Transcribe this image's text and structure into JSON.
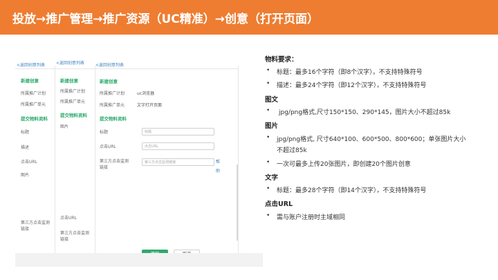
{
  "banner": {
    "title": "投放→推广管理→推广资源（UC精准）→创意（打开页面）"
  },
  "screenshot": {
    "back_links": [
      "返回创意列表",
      "返回创意列表",
      "返回创意列表"
    ],
    "col1": {
      "section_new": "新建创意",
      "plan_label": "所属推广计划",
      "unit_label": "所属推广单元",
      "section_submit": "提交物料资料",
      "title_label": "标题",
      "desc_label": "描述",
      "url_label": "点击URL",
      "image_label": "图片",
      "tracking_label_1": "第三方点击监测",
      "tracking_label_2": "链接"
    },
    "col2": {
      "section_new": "新建创意",
      "plan_label": "所属推广计划",
      "unit_label": "所属推广单元",
      "section_submit": "提交物料资料",
      "image_label": "图片",
      "url_label": "点击URL",
      "tracking_label_1": "第三方点击监测",
      "tracking_label_2": "链接"
    },
    "col3": {
      "section_new": "新建创意",
      "plan_label": "所属推广计划",
      "plan_value": "uc浏览器",
      "unit_label": "所属推广单元",
      "unit_value": "文字打开页面",
      "section_submit": "提交物料资料",
      "title_label": "标题",
      "title_placeholder": "标题",
      "url_label": "点击URL",
      "url_placeholder": "点击URL",
      "tracking_label_1": "第三方点击监测",
      "tracking_label_2": "链接",
      "tracking_placeholder": "第三方点击监测链接",
      "side_link_1": "帮",
      "side_link_2": "助"
    },
    "confirm_button": "确定",
    "cancel_button": "取消"
  },
  "requirements": {
    "heading": "物料要求：",
    "items": [
      {
        "type": "bullet",
        "text": "标题：最多16个字符（即8个汉字），不支持特殊符号"
      },
      {
        "type": "bullet",
        "text": "描述：最多24个字符（即12个汉字），不支持特殊符号"
      },
      {
        "type": "heading",
        "text": "图文"
      },
      {
        "type": "bullet",
        "text": "jpg/png格式,尺寸150*150、290*145，图片大小不超过85k"
      },
      {
        "type": "heading",
        "text": "图片"
      },
      {
        "type": "bullet",
        "text": "jpg/png格式, 尺寸640*100、600*500、800*600；单张图片大小"
      },
      {
        "type": "continuation",
        "text": "不超过85k"
      },
      {
        "type": "bullet",
        "text": "一次可最多上传20张图片，即创建20个图片创意"
      },
      {
        "type": "heading",
        "text": "文字"
      },
      {
        "type": "bullet",
        "text": "标题：最多28个字符（即14个汉字），不支持特殊符号"
      },
      {
        "type": "heading",
        "text": "点击URL"
      },
      {
        "type": "bullet",
        "text": "需与账户注册时主域相同"
      }
    ],
    "bullet_glyph": "•"
  },
  "colors": {
    "banner": "#ee7d31",
    "accent_green": "#2eaa6e",
    "link_blue": "#3c7fbf"
  }
}
